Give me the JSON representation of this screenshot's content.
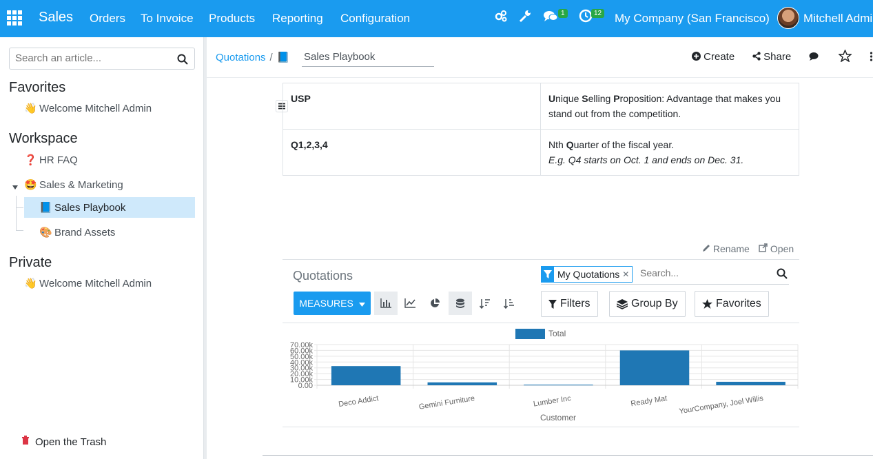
{
  "navbar": {
    "app_name": "Sales",
    "menu": [
      "Orders",
      "To Invoice",
      "Products",
      "Reporting",
      "Configuration"
    ],
    "messages_count": "1",
    "activities_count": "12",
    "company": "My Company (San Francisco)",
    "user": "Mitchell Admin",
    "color": "#1a9bef"
  },
  "sidebar": {
    "search_placeholder": "Search an article...",
    "favorites_title": "Favorites",
    "favorites": [
      {
        "emoji": "👋",
        "label": "Welcome Mitchell Admin"
      }
    ],
    "workspace_title": "Workspace",
    "workspace": [
      {
        "emoji": "❓",
        "label": "HR FAQ"
      },
      {
        "emoji": "🤩",
        "label": "Sales & Marketing"
      },
      {
        "emoji": "📘",
        "label": "Sales Playbook"
      },
      {
        "emoji": "🎨",
        "label": "Brand Assets"
      }
    ],
    "private_title": "Private",
    "private": [
      {
        "emoji": "👋",
        "label": "Welcome Mitchell Admin"
      }
    ],
    "trash_label": "Open the Trash"
  },
  "header": {
    "breadcrumb_parent": "Quotations",
    "article_emoji": "📘",
    "article_title": "Sales Playbook",
    "create_label": "Create",
    "share_label": "Share"
  },
  "glossary": [
    {
      "term": "USP",
      "definition": "Unique Selling Proposition: Advantage that makes you stand out from the competition.",
      "example": ""
    },
    {
      "term": "Q1,2,3,4",
      "definition": "Nth Quarter of the fiscal year.",
      "example": "E.g. Q4 starts on Oct. 1 and ends on Dec. 31."
    }
  ],
  "embedded_view": {
    "rename_label": "Rename",
    "open_label": "Open",
    "title": "Quotations",
    "facet_label": "My Quotations",
    "search_placeholder": "Search...",
    "measures_label": "MEASURES",
    "filters_label": "Filters",
    "groupby_label": "Group By",
    "favorites_label": "Favorites"
  },
  "chart_data": {
    "type": "bar",
    "title": "",
    "xlabel": "Customer",
    "ylabel": "",
    "legend_position": "top",
    "categories": [
      "Deco Addict",
      "Gemini Furniture",
      "Lumber Inc",
      "Ready Mat",
      "YourCompany, Joel Willis"
    ],
    "series": [
      {
        "name": "Total",
        "values": [
          33000,
          5000,
          1000,
          60000,
          6000
        ],
        "color": "#1f77b4"
      }
    ],
    "ylim": [
      0,
      70000
    ],
    "yticks": [
      "0.00",
      "10.00k",
      "20.00k",
      "30.00k",
      "40.00k",
      "50.00k",
      "60.00k",
      "70.00k"
    ],
    "grid": true
  }
}
